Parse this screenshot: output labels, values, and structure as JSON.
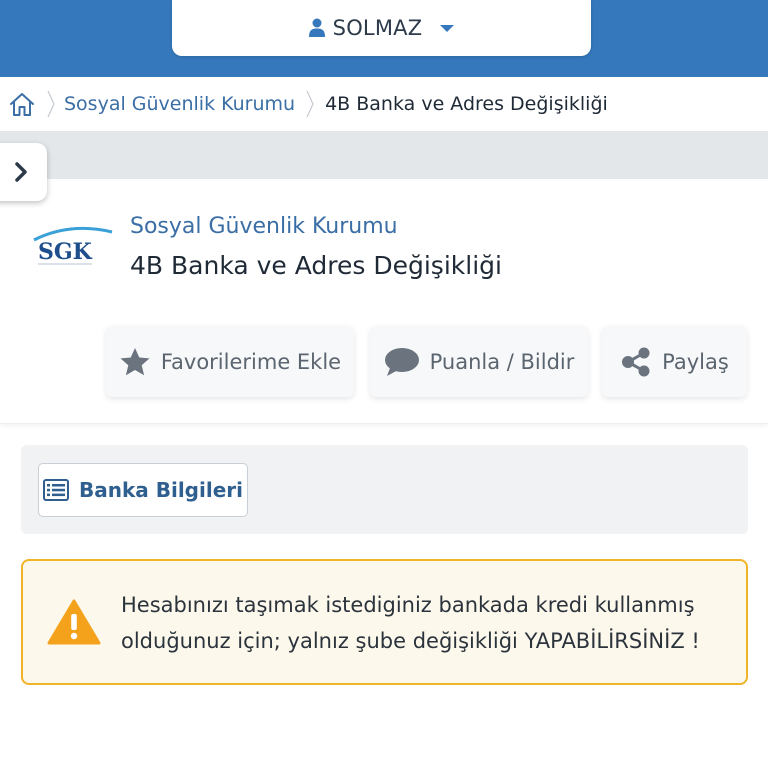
{
  "header": {
    "user_name": "SOLMAZ"
  },
  "breadcrumb": {
    "items": [
      "Sosyal Güvenlik Kurumu",
      "4B Banka ve Adres Değişikliği"
    ]
  },
  "service": {
    "institution": "Sosyal Güvenlik Kurumu",
    "title": "4B Banka ve Adres Değişikliği",
    "logo_text": "SGK"
  },
  "actions": {
    "favorite": "Favorilerime Ekle",
    "rate": "Puanla / Bildir",
    "share": "Paylaş"
  },
  "tabs": {
    "bank_info": "Banka Bilgileri"
  },
  "alert": {
    "message": "Hesabınızı taşımak istediginiz bankada kredi kullanmış olduğunuz için; yalnız şube değişikliği YAPABİLİRSİNİZ !"
  },
  "colors": {
    "brand_blue": "#3578bb",
    "link_blue": "#3a6ea5",
    "warning_orange": "#f0b429",
    "warning_bg": "#fdf8ec"
  },
  "icons": [
    "user-icon",
    "caret-down-icon",
    "home-icon",
    "chevron-right-icon",
    "star-icon",
    "comment-icon",
    "share-icon",
    "list-icon",
    "warning-icon"
  ]
}
